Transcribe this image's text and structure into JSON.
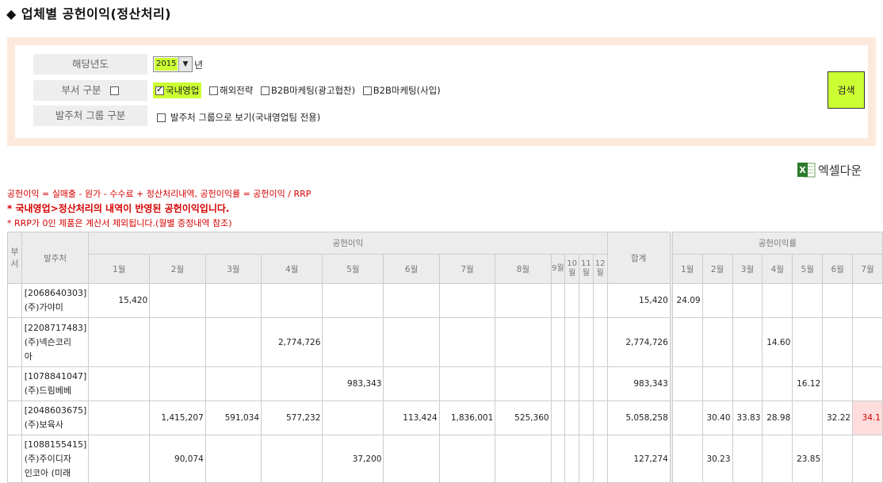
{
  "page": {
    "title": "◆ 업체별 공헌이익(정산처리)"
  },
  "search": {
    "year_label": "해당년도",
    "year_value": "2015",
    "year_unit": "년",
    "dept_label": "부서 구분",
    "dept_options": [
      {
        "label": "국내영업",
        "checked": true
      },
      {
        "label": "해외전략",
        "checked": false
      },
      {
        "label": "B2B마케팅(광고협찬)",
        "checked": false
      },
      {
        "label": "B2B마케팅(사입)",
        "checked": false
      }
    ],
    "group_label": "발주처 그룹 구분",
    "group_option": "발주처 그룹으로 보기(국내영업팀 전용)",
    "button": "검색"
  },
  "excel": {
    "label": "엑셀다운"
  },
  "notes": {
    "formula": "공헌이익 = 실매출 - 원가 - 수수료 + 정산처리내역, 공헌이익률 = 공헌이익 / RRP",
    "highlight": "* 국내영업>정산처리의 내역이 반영된 공헌이익입니다.",
    "exclude": "* RRP가 0인 제품은 계산서 제외됩니다.(월별 증정내역 참조)"
  },
  "table": {
    "col_dept": "부서",
    "col_vendor": "발주처",
    "group_profit": "공헌이익",
    "group_rate": "공헌이익률",
    "col_total": "합계",
    "months": [
      "1월",
      "2월",
      "3월",
      "4월",
      "5월",
      "6월",
      "7월",
      "8월",
      "9월",
      "10월",
      "11월",
      "12월"
    ],
    "rate_months": [
      "1월",
      "2월",
      "3월",
      "4월",
      "5월",
      "6월",
      "7월"
    ],
    "rows": [
      {
        "vendor": [
          "[2068640303]",
          "(주)가야미"
        ],
        "profit": [
          "15,420",
          "",
          "",
          "",
          "",
          "",
          "",
          "",
          "",
          "",
          "",
          ""
        ],
        "total": "15,420",
        "rate": [
          "24.09",
          "",
          "",
          "",
          "",
          "",
          ""
        ]
      },
      {
        "vendor": [
          "[2208717483]",
          "(주)넥슨코리",
          "아"
        ],
        "profit": [
          "",
          "",
          "",
          "2,774,726",
          "",
          "",
          "",
          "",
          "",
          "",
          "",
          ""
        ],
        "total": "2,774,726",
        "rate": [
          "",
          "",
          "",
          "14.60",
          "",
          "",
          ""
        ]
      },
      {
        "vendor": [
          "[1078841047]",
          "(주)드림베베"
        ],
        "profit": [
          "",
          "",
          "",
          "",
          "983,343",
          "",
          "",
          "",
          "",
          "",
          "",
          ""
        ],
        "total": "983,343",
        "rate": [
          "",
          "",
          "",
          "",
          "16.12",
          "",
          ""
        ]
      },
      {
        "vendor": [
          "[2048603675]",
          "(주)보육사"
        ],
        "profit": [
          "",
          "1,415,207",
          "591,034",
          "577,232",
          "",
          "113,424",
          "1,836,001",
          "525,360",
          "",
          "",
          "",
          ""
        ],
        "total": "5,058,258",
        "rate": [
          "",
          "30.40",
          "33.83",
          "28.98",
          "",
          "32.22",
          "34.1"
        ]
      },
      {
        "vendor": [
          "[1088155415]",
          "(주)주이디자",
          "인코아 (미래"
        ],
        "profit": [
          "",
          "90,074",
          "",
          "",
          "37,200",
          "",
          "",
          "",
          "",
          "",
          "",
          ""
        ],
        "total": "127,274",
        "rate": [
          "",
          "30.23",
          "",
          "",
          "23.85",
          "",
          ""
        ]
      }
    ]
  },
  "colors": {
    "accent": "#ccff33",
    "border_frame": "#fde9dc",
    "note_red": "#d40000",
    "pink_cell": "#ffdddd"
  }
}
